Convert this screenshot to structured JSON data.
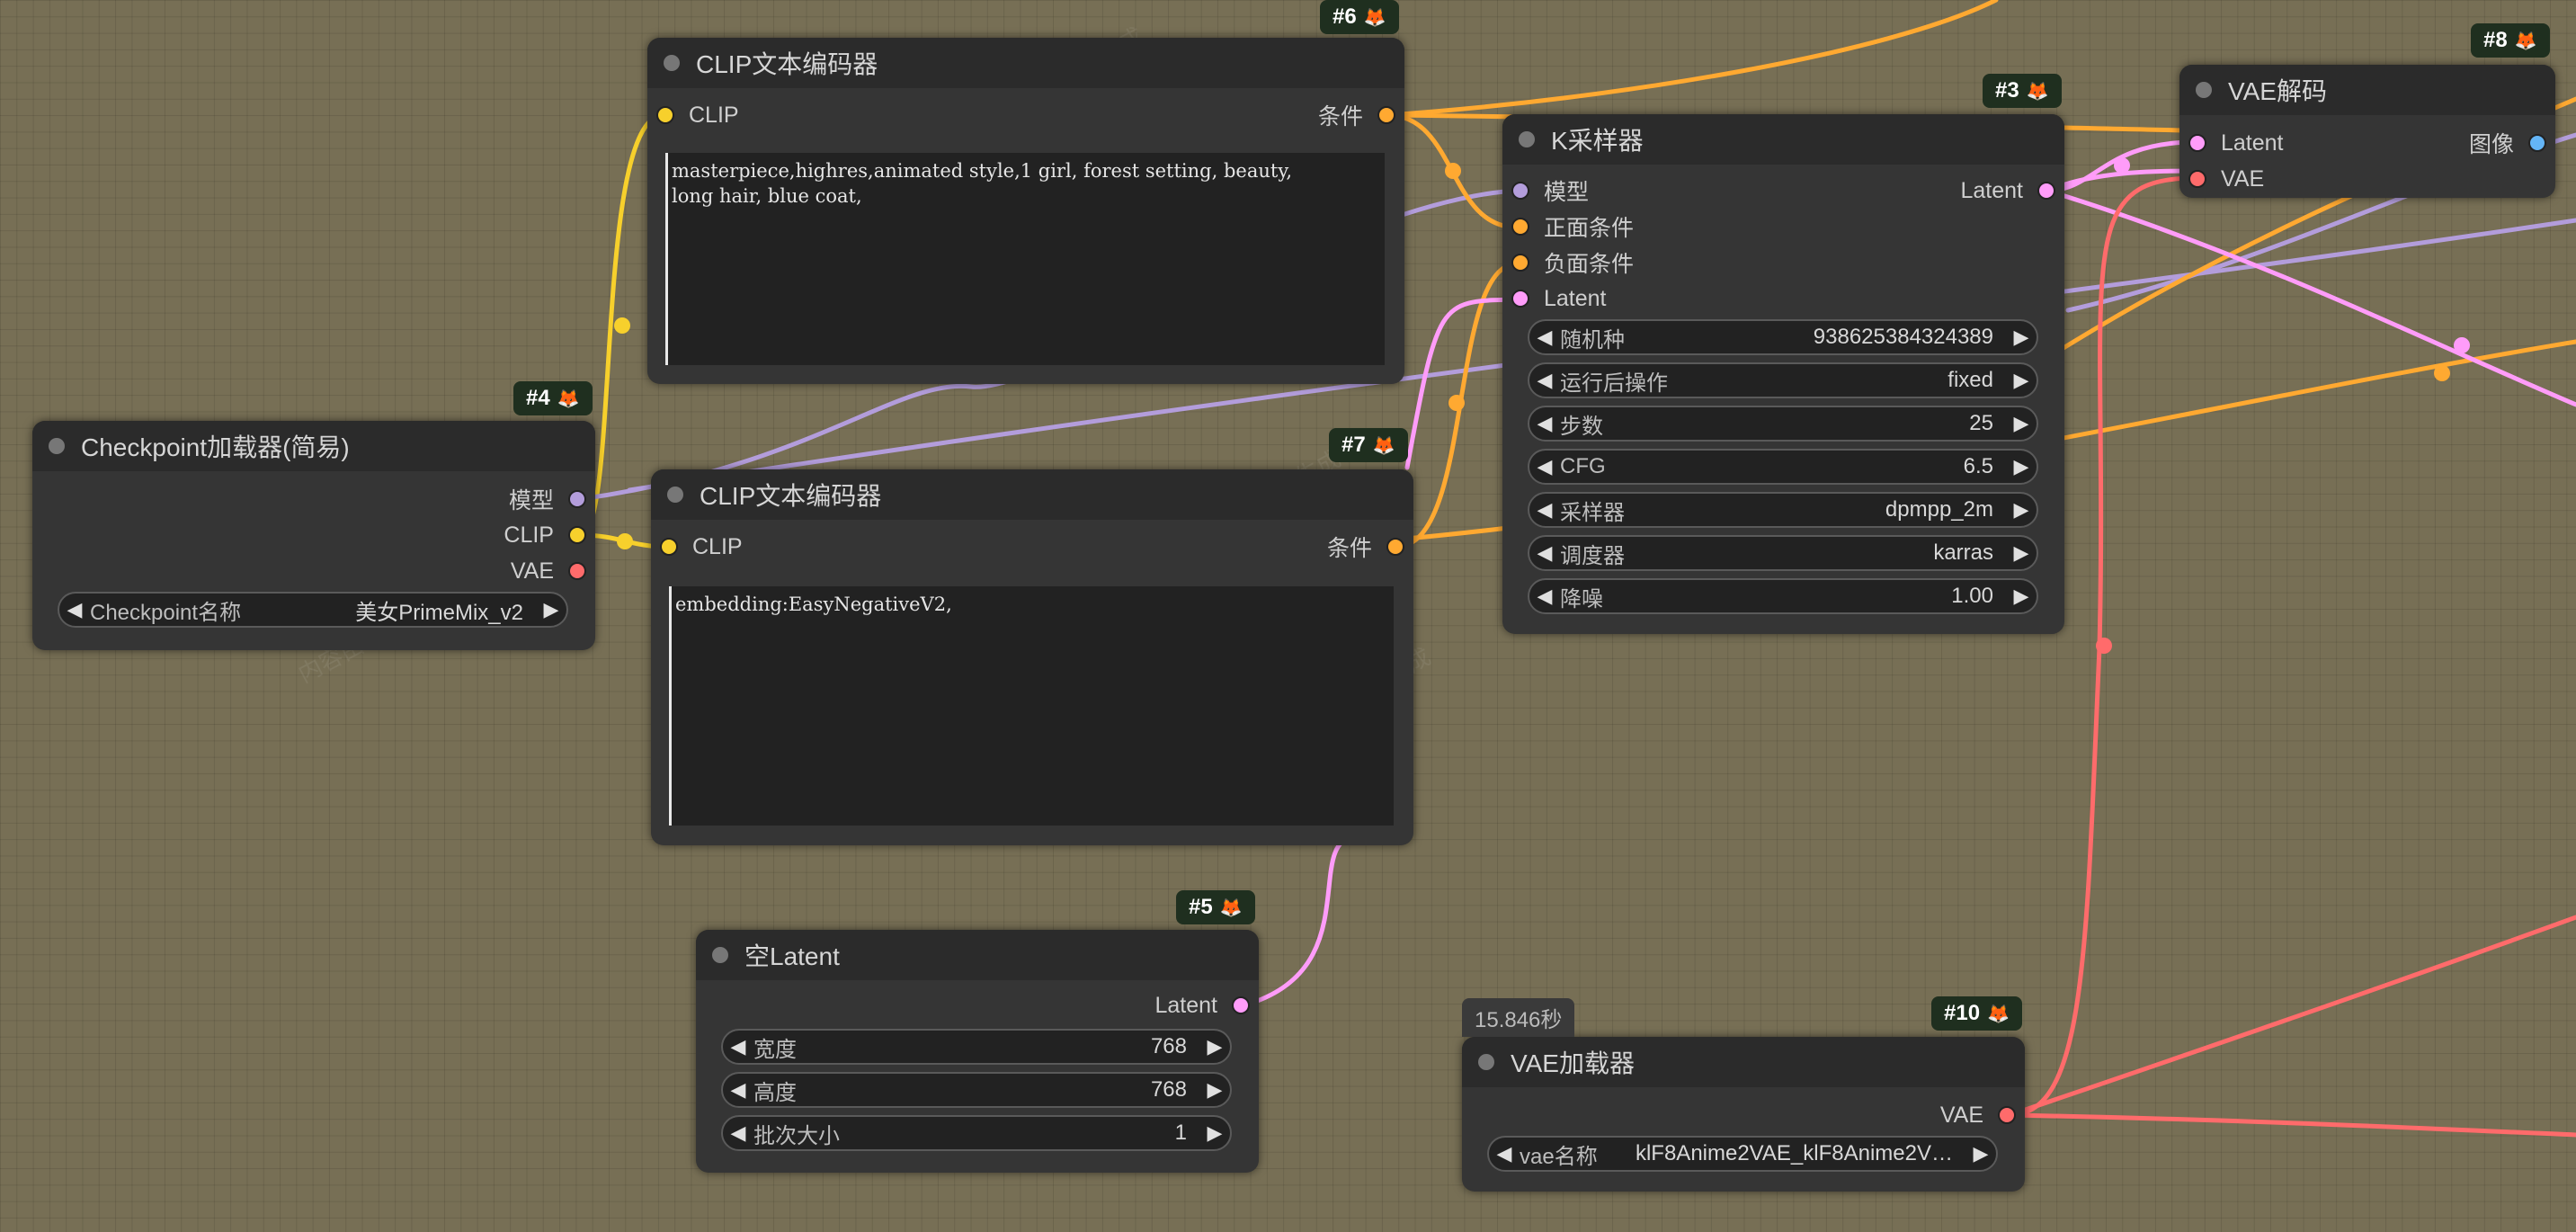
{
  "colors": {
    "clip": "#f7d02c",
    "model": "#b39ddb",
    "vae": "#ff6b6b",
    "conditioning": "#ffa931",
    "latent": "#ff9cf9",
    "image": "#64b5f6"
  },
  "nodes": {
    "clip_encoder_pos": {
      "badge": "#6",
      "title": "CLIP文本编码器",
      "in_clip": "CLIP",
      "out_cond": "条件",
      "text": "masterpiece,highres,animated style,1 girl, forest setting, beauty,\nlong hair, blue coat,"
    },
    "clip_encoder_neg": {
      "badge": "#7",
      "title": "CLIP文本编码器",
      "in_clip": "CLIP",
      "out_cond": "条件",
      "text": "embedding:EasyNegativeV2,"
    },
    "checkpoint_loader": {
      "badge": "#4",
      "title": "Checkpoint加载器(简易)",
      "out_model": "模型",
      "out_clip": "CLIP",
      "out_vae": "VAE",
      "widget_label": "Checkpoint名称",
      "widget_value": "美女PrimeMix_v2"
    },
    "ksampler": {
      "badge": "#3",
      "title": "K采样器",
      "in_model": "模型",
      "in_positive": "正面条件",
      "in_negative": "负面条件",
      "in_latent": "Latent",
      "out_latent": "Latent",
      "widgets": [
        {
          "label": "随机种",
          "value": "938625384324389"
        },
        {
          "label": "运行后操作",
          "value": "fixed"
        },
        {
          "label": "步数",
          "value": "25"
        },
        {
          "label": "CFG",
          "value": "6.5"
        },
        {
          "label": "采样器",
          "value": "dpmpp_2m"
        },
        {
          "label": "调度器",
          "value": "karras"
        },
        {
          "label": "降噪",
          "value": "1.00"
        }
      ]
    },
    "vae_decode": {
      "badge": "#8",
      "title": "VAE解码",
      "in_latent": "Latent",
      "in_vae": "VAE",
      "out_image": "图像"
    },
    "empty_latent": {
      "badge": "#5",
      "title": "空Latent",
      "out_latent": "Latent",
      "widgets": [
        {
          "label": "宽度",
          "value": "768"
        },
        {
          "label": "高度",
          "value": "768"
        },
        {
          "label": "批次大小",
          "value": "1"
        }
      ]
    },
    "vae_loader": {
      "badge": "#10",
      "title": "VAE加载器",
      "timer": "15.846秒",
      "out_vae": "VAE",
      "widget_label": "vae名称",
      "widget_value": "klF8Anime2VAE_klF8Anime2V…"
    }
  },
  "arrows": {
    "left": "◀",
    "right": "▶"
  },
  "badge_icon": "fox-icon",
  "watermark": "内容由Liblib AI生成"
}
